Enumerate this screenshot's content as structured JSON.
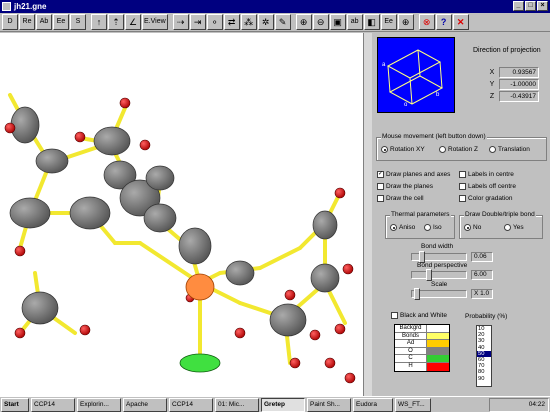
{
  "window": {
    "title": "jh21.gne"
  },
  "toolbar": {
    "buttons": [
      "D",
      "Re",
      "Ab",
      "Ee",
      "S",
      "E.View",
      "ab",
      "Ee"
    ],
    "close_label": "✕"
  },
  "projection": {
    "title": "Direction of projection",
    "x_label": "X",
    "x_value": "0.93567",
    "y_label": "Y",
    "y_value": "-1.00000",
    "z_label": "Z",
    "z_value": "-0.43917"
  },
  "mouse": {
    "caption": "Mouse movement (left button down)",
    "options": [
      "Rotation XY",
      "Rotation Z",
      "Translation"
    ],
    "selected": "Rotation XY"
  },
  "display": {
    "checkboxes": [
      {
        "label": "Draw planes and axes",
        "checked": true
      },
      {
        "label": "Draw the planes",
        "checked": false
      },
      {
        "label": "Draw the cell",
        "checked": false
      },
      {
        "label": "Labels in centre",
        "checked": false
      },
      {
        "label": "Labels off centre",
        "checked": false
      },
      {
        "label": "Color gradation",
        "checked": false
      }
    ]
  },
  "thermal": {
    "caption": "Thermal parameters",
    "options": [
      "Aniso",
      "Iso"
    ],
    "selected": "Aniso"
  },
  "bond_draw": {
    "caption": "Draw Double/triple bond",
    "options": [
      "No",
      "Yes"
    ],
    "selected": "No"
  },
  "sliders": {
    "bond_width": {
      "label": "Bond width",
      "value": "0.06",
      "level": 0.15
    },
    "bond_perspective": {
      "label": "Bond perspective",
      "value": "6.00",
      "level": 0.3
    },
    "scale": {
      "label": "Scale",
      "value": "X 1.0",
      "level": 0.05
    }
  },
  "black_white": {
    "label": "Black and White",
    "checked": false
  },
  "probability": {
    "label": "Probability (%)",
    "options": [
      "10",
      "20",
      "30",
      "40",
      "50",
      "60",
      "70",
      "80",
      "90"
    ],
    "selected": "50"
  },
  "colors": [
    {
      "name": "Backgrd",
      "color": "#ffffff"
    },
    {
      "name": "Bonds",
      "color": "#ffff66"
    },
    {
      "name": "Ad",
      "color": "#ffcc00"
    },
    {
      "name": "O",
      "color": "#808080"
    },
    {
      "name": "C",
      "color": "#33cc33"
    },
    {
      "name": "H",
      "color": "#ff0000"
    }
  ],
  "taskbar": {
    "start": "Start",
    "tasks": [
      "CCP14",
      "Explorin...",
      "Apache",
      "CCP14",
      "01: Mic...",
      "Gretep",
      "Paint Sh...",
      "Eudora",
      "WS_FT..."
    ],
    "active": "Gretep",
    "clock": "04:22"
  }
}
